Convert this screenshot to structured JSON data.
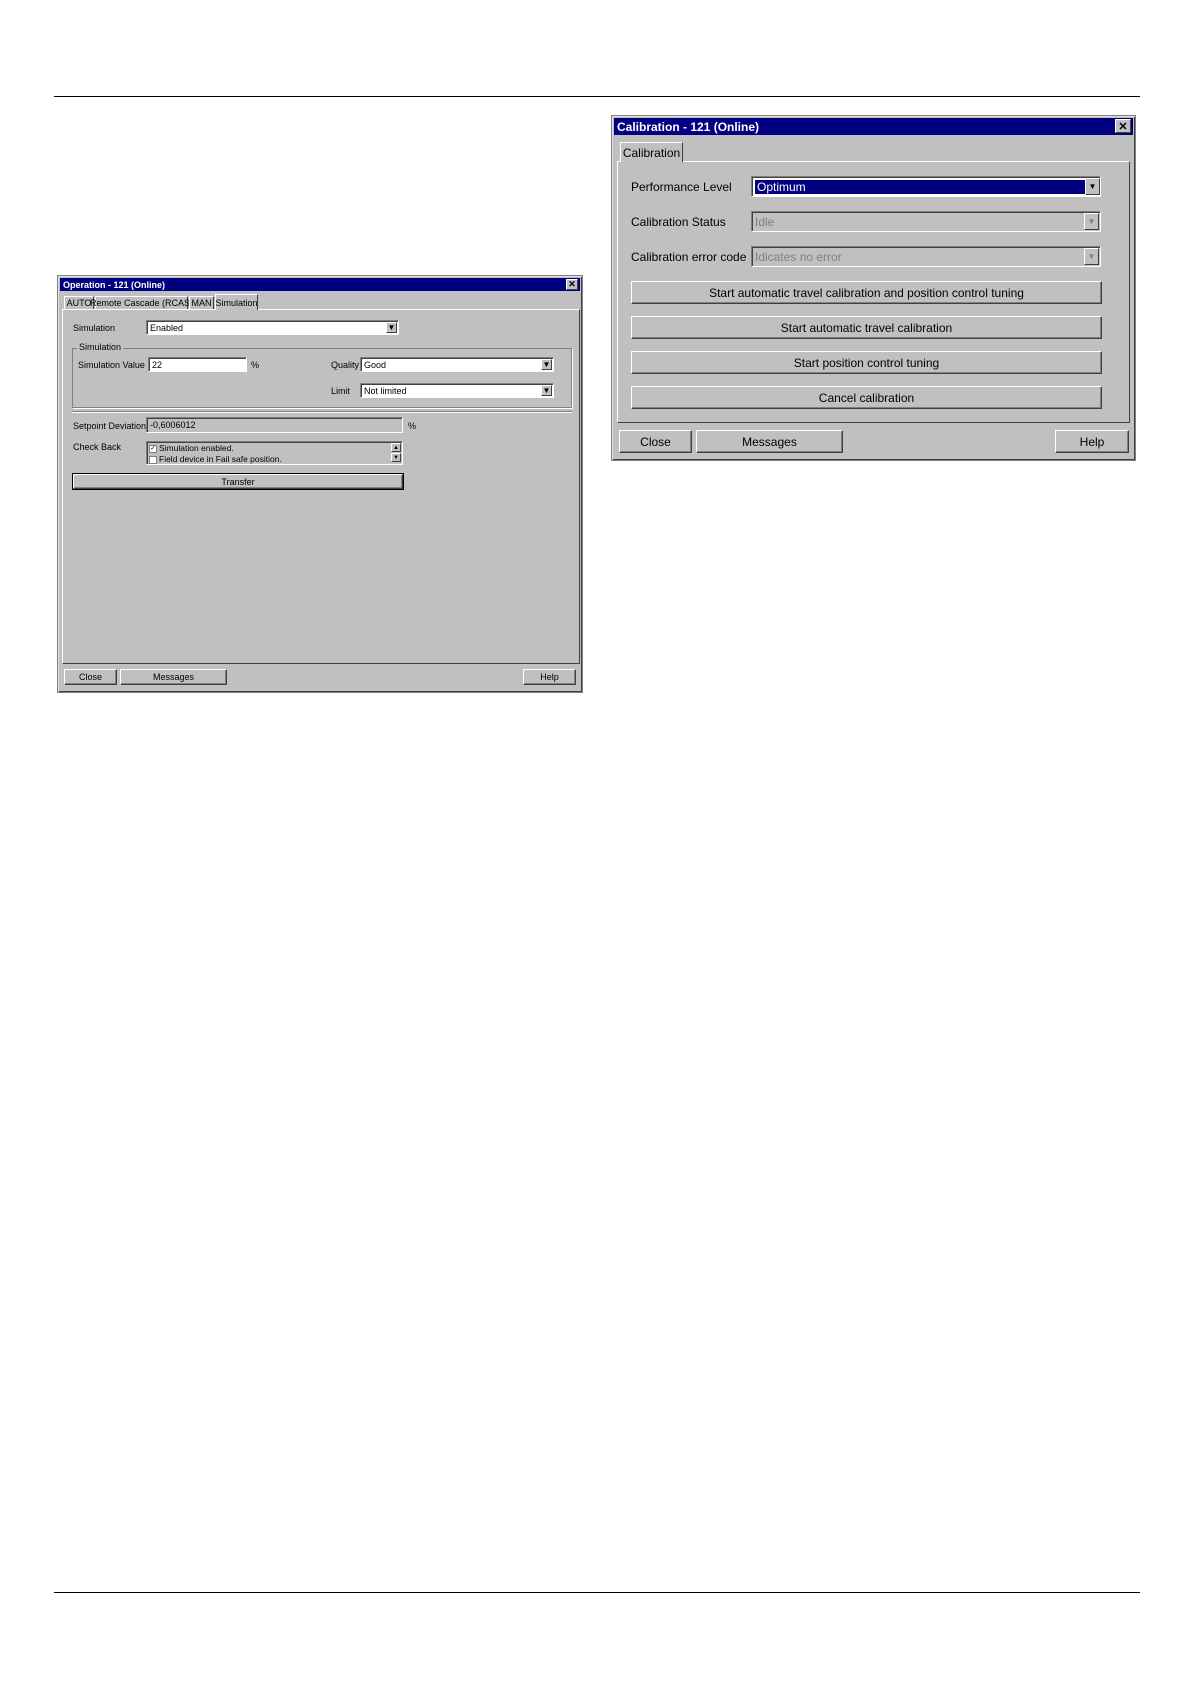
{
  "operation": {
    "title": "Operation - 121  (Online)",
    "tabs": [
      {
        "label": "AUTO"
      },
      {
        "label": "Remote Cascade (RCAS)"
      },
      {
        "label": "MAN"
      },
      {
        "label": "Simulation"
      }
    ],
    "simulation_label": "Simulation",
    "simulation_value_selected": "Enabled",
    "group_title": "Simulation",
    "sim_value_label": "Simulation Value",
    "sim_value": "22",
    "sim_unit": "%",
    "quality_label": "Quality",
    "quality_value": "Good",
    "limit_label": "Limit",
    "limit_value": "Not limited",
    "setpoint_label": "Setpoint Deviation",
    "setpoint_value": "-0,6006012",
    "setpoint_unit": "%",
    "checkback_label": "Check Back",
    "checkback_items": [
      {
        "label": "Simulation enabled.",
        "checked": true
      },
      {
        "label": "Field device in Fail safe position.",
        "checked": false
      }
    ],
    "transfer_label": "Transfer",
    "close_label": "Close",
    "messages_label": "Messages",
    "help_label": "Help"
  },
  "calibration": {
    "title": "Calibration - 121  (Online)",
    "tab_label": "Calibration",
    "performance_label": "Performance Level",
    "performance_value": "Optimum",
    "status_label": "Calibration Status",
    "status_value": "Idle",
    "error_label": "Calibration error code",
    "error_value": "Idicates no error",
    "btn_full": "Start automatic travel calibration and position control tuning",
    "btn_travel": "Start automatic travel calibration",
    "btn_tuning": "Start position control tuning",
    "btn_cancel": "Cancel calibration",
    "close_label": "Close",
    "messages_label": "Messages",
    "help_label": "Help"
  }
}
